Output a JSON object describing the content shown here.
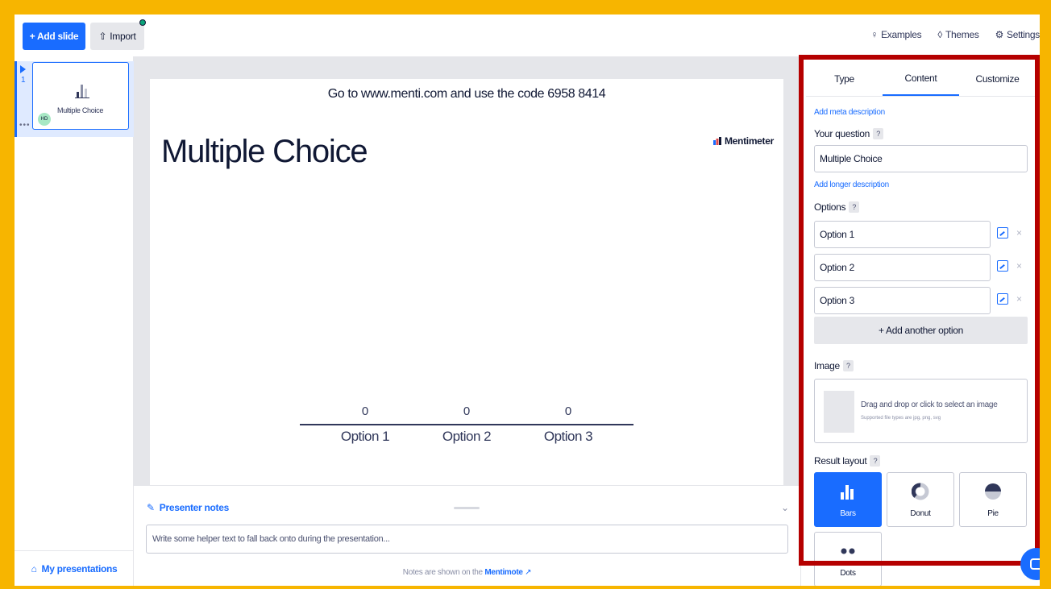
{
  "toolbar": {
    "add_slide": "+ Add slide",
    "import": "Import",
    "examples": "Examples",
    "themes": "Themes",
    "settings": "Settings"
  },
  "sidebar": {
    "slide_number": "1",
    "slide_title": "Multiple Choice",
    "avatar_initials": "HD",
    "dots": "•••",
    "my_presentations": "My presentations"
  },
  "slide": {
    "code_line": "Go to www.menti.com and use the code 6958 8414",
    "title": "Multiple Choice",
    "brand": "Mentimeter"
  },
  "chart_data": {
    "type": "bar",
    "categories": [
      "Option 1",
      "Option 2",
      "Option 3"
    ],
    "values": [
      0,
      0,
      0
    ],
    "title": "Multiple Choice",
    "xlabel": "",
    "ylabel": ""
  },
  "notes": {
    "header": "Presenter notes",
    "placeholder": "Write some helper text to fall back onto during the presentation...",
    "footer_prefix": "Notes are shown on the",
    "footer_link": "Mentimote"
  },
  "panel": {
    "tabs": [
      {
        "label": "Type"
      },
      {
        "label": "Content"
      },
      {
        "label": "Customize"
      }
    ],
    "active_tab": "Content",
    "add_meta": "Add meta description",
    "question_label": "Your question",
    "question_value": "Multiple Choice",
    "add_longer": "Add longer description",
    "options_label": "Options",
    "options": [
      "Option 1",
      "Option 2",
      "Option 3"
    ],
    "add_option": "+ Add another option",
    "image_label": "Image",
    "image_drop": "Drag and drop or click to select an image",
    "image_types": "Supported file types are jpg, png, svg",
    "result_layout_label": "Result layout",
    "layouts": [
      {
        "label": "Bars",
        "active": true
      },
      {
        "label": "Donut",
        "active": false
      },
      {
        "label": "Pie",
        "active": false
      },
      {
        "label": "Dots",
        "active": false
      }
    ]
  },
  "colors": {
    "accent": "#196cff",
    "frame": "#f7b500",
    "highlight_outline": "#b50000"
  }
}
